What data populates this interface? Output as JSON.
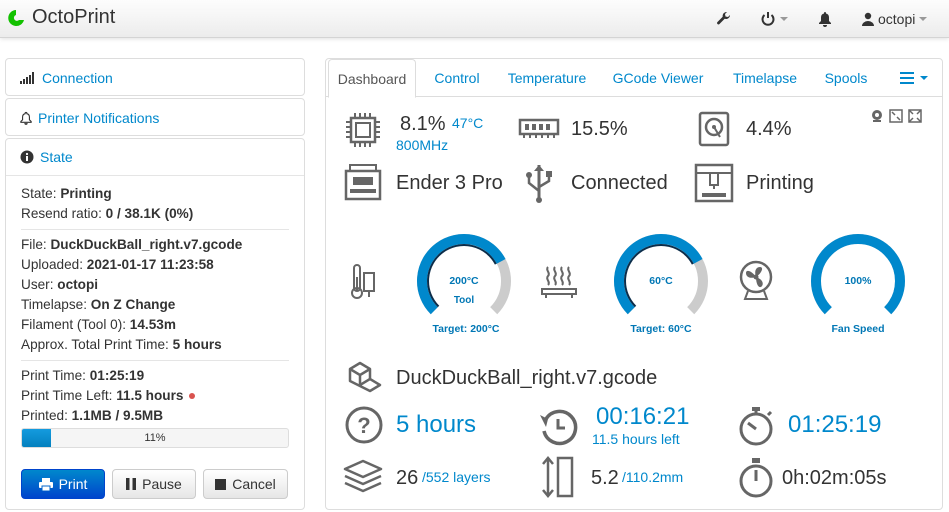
{
  "navbar": {
    "brand": "OctoPrint",
    "user": "octopi"
  },
  "sidebar": {
    "connection": "Connection",
    "notifications": "Printer Notifications",
    "state_title": "State",
    "state": {
      "state_label": "State:",
      "state_value": "Printing",
      "resend_label": "Resend ratio:",
      "resend_value": "0 / 38.1K (0%)",
      "file_label": "File:",
      "file_value": "DuckDuckBall_right.v7.gcode",
      "uploaded_label": "Uploaded:",
      "uploaded_value": "2021-01-17 11:23:58",
      "user_label": "User:",
      "user_value": "octopi",
      "timelapse_label": "Timelapse:",
      "timelapse_value": "On Z Change",
      "filament_label": "Filament (Tool 0):",
      "filament_value": "14.53m",
      "approx_label": "Approx. Total Print Time:",
      "approx_value": "5 hours",
      "print_time_label": "Print Time:",
      "print_time_value": "01:25:19",
      "time_left_label": "Print Time Left:",
      "time_left_value": "11.5 hours",
      "printed_label": "Printed:",
      "printed_value": "1.1MB / 9.5MB",
      "progress_percent": 11,
      "progress_text": "11%"
    },
    "buttons": {
      "print": "Print",
      "pause": "Pause",
      "cancel": "Cancel"
    }
  },
  "tabs": [
    "Dashboard",
    "Control",
    "Temperature",
    "GCode Viewer",
    "Timelapse",
    "Spools"
  ],
  "dashboard": {
    "cpu_load": "8.1%",
    "cpu_temp": "47°C",
    "cpu_freq": "800MHz",
    "memory": "15.5%",
    "disk": "4.4%",
    "printer_name": "Ender 3 Pro",
    "connection_status": "Connected",
    "print_status": "Printing",
    "hotend": {
      "value": "200°C",
      "sub": "Tool",
      "target": "Target: 200°C",
      "fraction": 0.73
    },
    "bed": {
      "value": "60°C",
      "target": "Target: 60°C",
      "fraction": 0.73
    },
    "fan": {
      "value": "100%",
      "label": "Fan Speed",
      "fraction": 1.0
    },
    "filename": "DuckDuckBall_right.v7.gcode",
    "est_total": "5 hours",
    "time_left": "00:16:21",
    "time_left_sub": "11.5 hours left",
    "elapsed": "01:25:19",
    "layer_current": "26",
    "layer_total": "/552 layers",
    "height_current": "5.2",
    "height_total": "/110.2mm",
    "layer_time": "0h:02m:05s"
  },
  "colors": {
    "accent": "#0088cc",
    "gauge_fill": "#0088cc",
    "gauge_track": "#cccccc",
    "icon_gray": "#666666",
    "progress_fill": "#149bdf"
  }
}
